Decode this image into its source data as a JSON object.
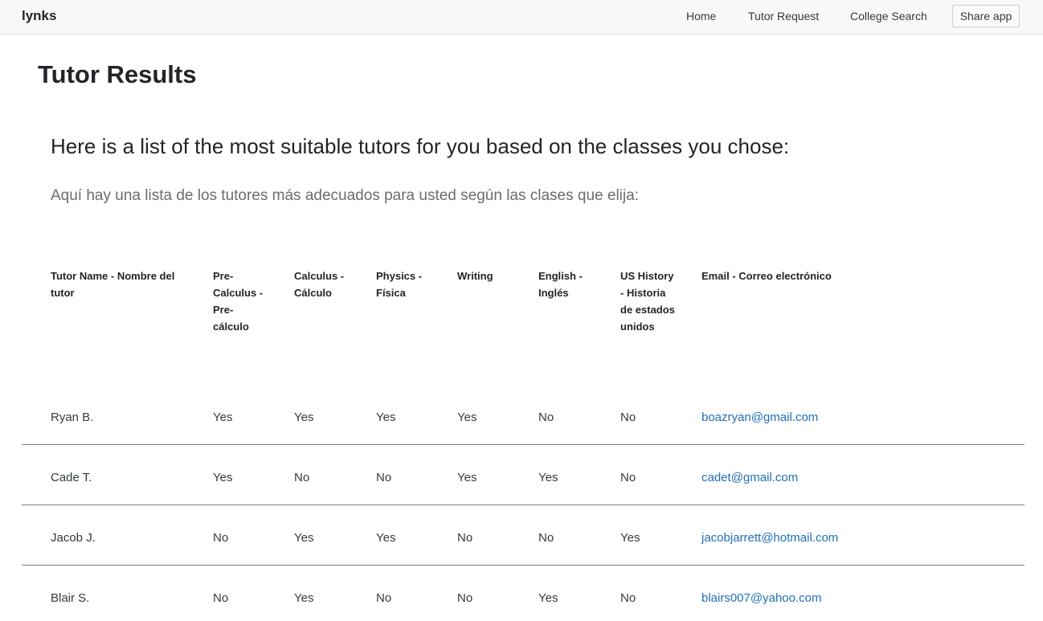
{
  "navbar": {
    "brand": "lynks",
    "links": [
      "Home",
      "Tutor Request",
      "College Search"
    ],
    "share_label": "Share app"
  },
  "page": {
    "title": "Tutor Results",
    "lead_en": "Here is a list of the most suitable tutors for you based on the classes you chose:",
    "lead_es": "Aquí hay una lista de los tutores más adecuados para usted según las clases que elija:"
  },
  "table": {
    "headers": [
      "Tutor Name  - Nombre del tutor",
      "Pre-Calculus - Pre-cálculo",
      "Calculus - Cálculo",
      "Physics - Física",
      "Writing",
      "English - Inglés",
      "US History - Historia de estados unidos",
      "Email - Correo electrónico"
    ],
    "rows": [
      {
        "name": "Ryan B.",
        "precalc": "Yes",
        "calc": "Yes",
        "physics": "Yes",
        "writing": "Yes",
        "english": "No",
        "history": "No",
        "email": "boazryan@gmail.com"
      },
      {
        "name": "Cade T.",
        "precalc": "Yes",
        "calc": "No",
        "physics": "No",
        "writing": "Yes",
        "english": "Yes",
        "history": "No",
        "email": "cadet@gmail.com"
      },
      {
        "name": "Jacob J.",
        "precalc": "No",
        "calc": "Yes",
        "physics": "Yes",
        "writing": "No",
        "english": "No",
        "history": "Yes",
        "email": "jacobjarrett@hotmail.com"
      },
      {
        "name": "Blair S.",
        "precalc": "No",
        "calc": "Yes",
        "physics": "No",
        "writing": "No",
        "english": "Yes",
        "history": "No",
        "email": "blairs007@yahoo.com"
      }
    ]
  },
  "colors": {
    "link": "#1f6fb5",
    "navbar_bg": "#f8f8f8",
    "muted_text": "#6c6c6c"
  }
}
